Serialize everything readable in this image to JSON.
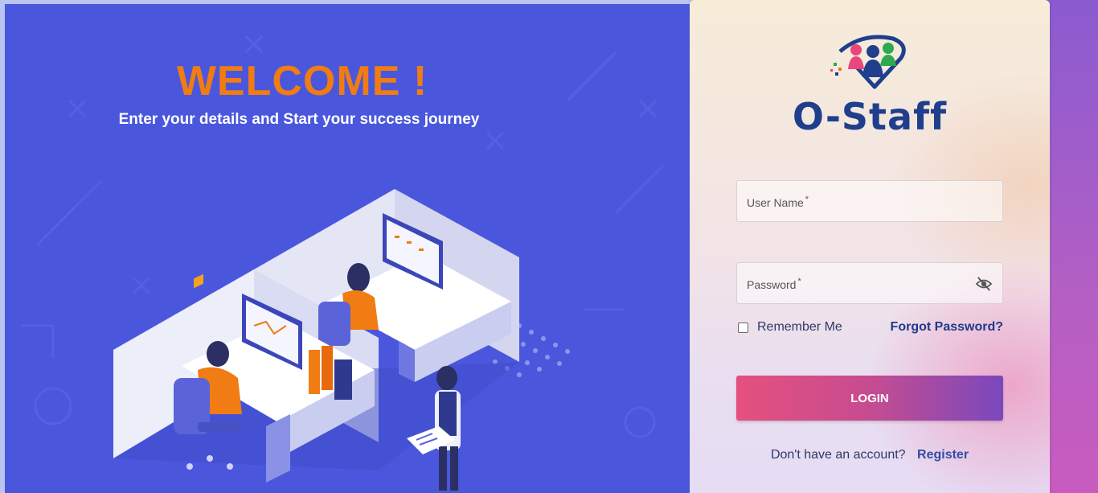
{
  "hero": {
    "title": "WELCOME !",
    "subtitle": "Enter your details and Start your success journey"
  },
  "brand": {
    "name": "O-Staff",
    "primary_color": "#1f3f8c",
    "accent_color": "#f07c13"
  },
  "form": {
    "username_label": "User Name",
    "password_label": "Password",
    "required_marker": "*",
    "remember_label": "Remember Me",
    "remember_checked": false,
    "forgot_label": "Forgot Password?",
    "login_label": "LOGIN",
    "no_account_text": "Don't have an account?",
    "register_label": "Register"
  },
  "icons": {
    "password_toggle": "eye-off-icon",
    "logo": "people-heart-logo-icon"
  }
}
